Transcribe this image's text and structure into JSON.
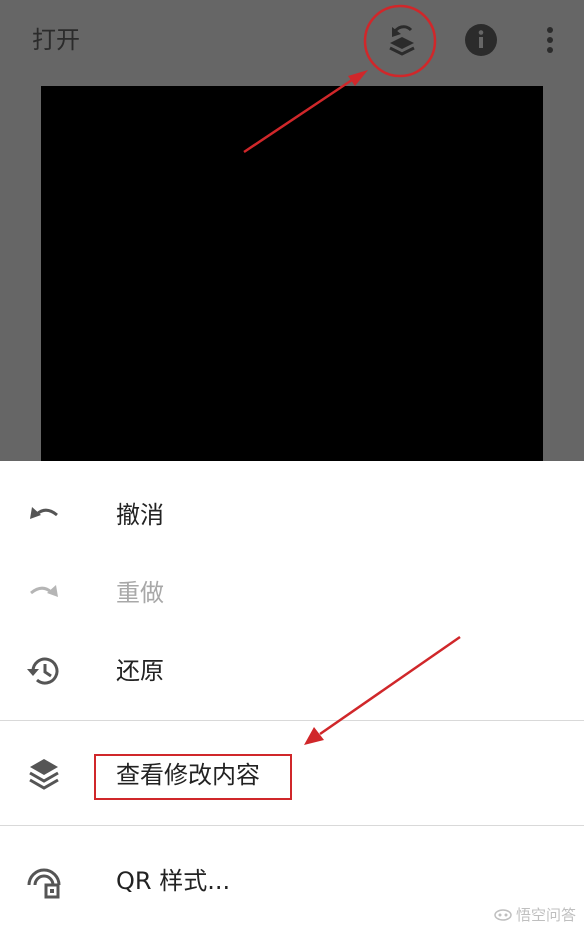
{
  "topbar": {
    "open_label": "打开",
    "icons": [
      "layers-undo-icon",
      "info-icon",
      "more-vert-icon"
    ]
  },
  "menu": {
    "items": [
      {
        "label": "撤消",
        "icon": "undo-icon",
        "enabled": true
      },
      {
        "label": "重做",
        "icon": "redo-icon",
        "enabled": false
      },
      {
        "label": "还原",
        "icon": "restore-history-icon",
        "enabled": true
      },
      {
        "label": "查看修改内容",
        "icon": "layers-icon",
        "enabled": true
      },
      {
        "label": "QR 样式...",
        "icon": "qr-style-icon",
        "enabled": true
      }
    ]
  },
  "watermark": {
    "text": "悟空问答"
  },
  "colors": {
    "annotation_red": "#d0272a",
    "dim_background": "#666666",
    "photo": "#000000",
    "sheet": "#ffffff"
  }
}
